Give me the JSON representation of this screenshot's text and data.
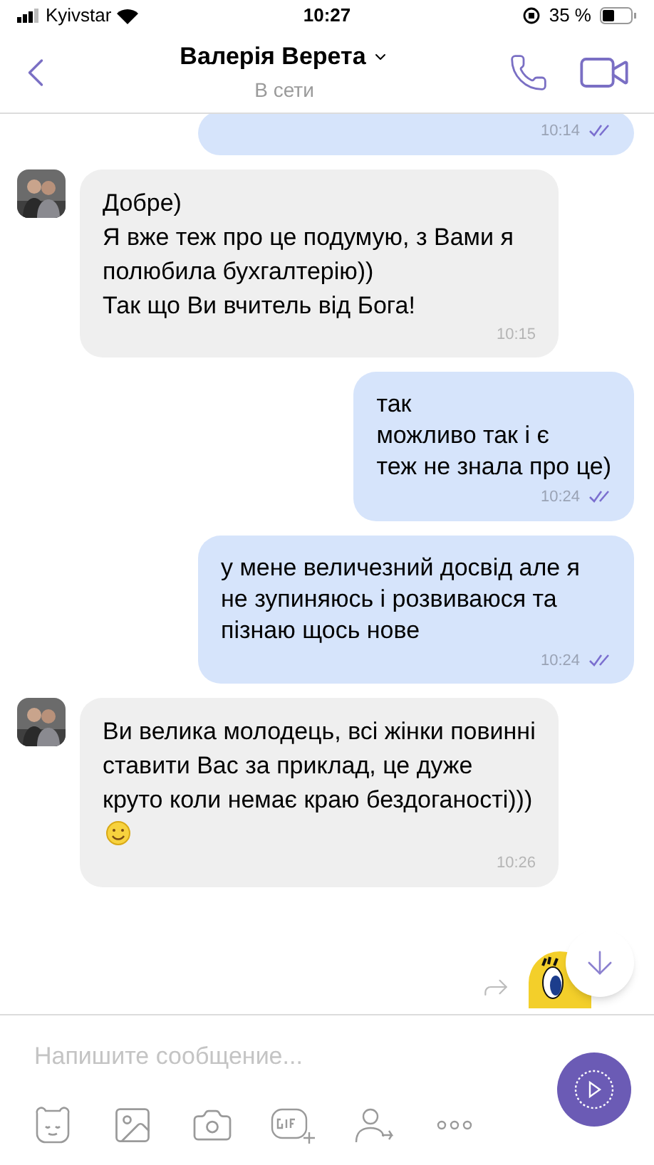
{
  "status_bar": {
    "carrier": "Kyivstar",
    "time": "10:27",
    "battery": "35 %"
  },
  "header": {
    "name": "Валерія Верета",
    "status": "В сети"
  },
  "messages": [
    {
      "kind": "outgoing",
      "time": "10:14",
      "read": true
    },
    {
      "kind": "incoming",
      "text": "Добре)\nЯ вже теж про це подумую, з Вами я полюбила бухгалтерію))\nТак що Ви вчитель від Бога!",
      "time": "10:15",
      "smiley": false
    },
    {
      "kind": "outgoing",
      "text": "так\nможливо так і є\nтеж не знала про це)",
      "time": "10:24",
      "read": true
    },
    {
      "kind": "outgoing",
      "text": "у мене величезний досвід але я не зупиняюсь і розвиваюся та пізнаю щось нове",
      "time": "10:24",
      "read": true
    },
    {
      "kind": "incoming",
      "text": "Ви велика молодець, всі жінки повинні ставити Вас за приклад, це дуже круто коли немає краю бездоганості)))",
      "time": "10:26",
      "smiley": true
    }
  ],
  "composer": {
    "placeholder": "Напишите сообщение..."
  }
}
